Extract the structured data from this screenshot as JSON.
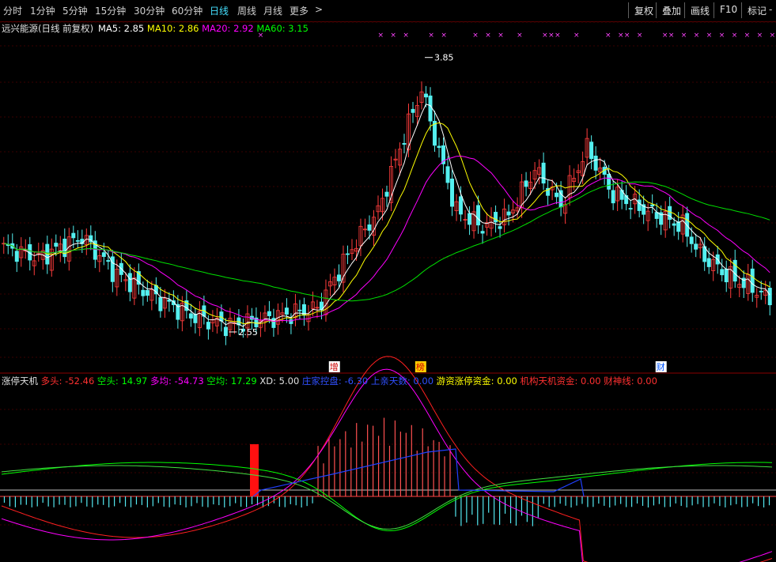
{
  "toolbar": {
    "periods": [
      "分时",
      "1分钟",
      "5分钟",
      "15分钟",
      "30分钟",
      "60分钟",
      "日线",
      "周线",
      "月线",
      "更多"
    ],
    "active_period": "日线",
    "more_arrow": ">",
    "right_buttons": [
      "复权",
      "叠加",
      "画线",
      "F10",
      "标记"
    ],
    "edge": "-"
  },
  "chart_data": [
    {
      "type": "candlestick",
      "title": "远兴能源(日线 前复权)",
      "ma_labels": [
        {
          "name": "MA5",
          "value": "2.85",
          "color": "#ffffff"
        },
        {
          "name": "MA10",
          "value": "2.86",
          "color": "#ffff00"
        },
        {
          "name": "MA20",
          "value": "2.92",
          "color": "#ff00ff"
        },
        {
          "name": "MA60",
          "value": "3.15",
          "color": "#00ff00"
        }
      ],
      "ylim": [
        2.43,
        3.95
      ],
      "high_marker": "3.85",
      "low_marker": "2.55",
      "high_value": 3.85,
      "low_value": 2.55,
      "event_tags": [
        {
          "text": "增",
          "pos": 0.432,
          "bg": "#ffffff",
          "fg": "#cc0000"
        },
        {
          "text": "榜",
          "pos": 0.544,
          "bg": "#ffd000",
          "fg": "#cc0000"
        },
        {
          "text": "财",
          "pos": 0.856,
          "bg": "#ffffff",
          "fg": "#0055ff"
        }
      ],
      "x_mark": "×",
      "x_mark_groups": [
        [
          0.23
        ],
        [
          0.42,
          0.44,
          0.46
        ],
        [
          0.5,
          0.52
        ],
        [
          0.57,
          0.59
        ],
        [
          0.61
        ],
        [
          0.64
        ],
        [
          0.68,
          0.69,
          0.7
        ],
        [
          0.73
        ],
        [
          0.78
        ],
        [
          0.8
        ],
        [
          0.81
        ],
        [
          0.83
        ],
        [
          0.87
        ],
        [
          0.88
        ],
        [
          0.9
        ],
        [
          0.92
        ],
        [
          0.94
        ],
        [
          0.96
        ],
        [
          0.98
        ],
        [
          1.0
        ],
        [
          1.02
        ],
        [
          1.04
        ],
        [
          1.08
        ],
        [
          1.11
        ],
        [
          1.14
        ]
      ],
      "colors": {
        "up": "#ff3c3c",
        "down": "#54f0f0",
        "ma5": "#ffffff",
        "ma10": "#ffff00",
        "ma20": "#ff00ff",
        "ma60": "#00e000"
      }
    },
    {
      "type": "indicator",
      "labels": [
        {
          "name": "涨停天机",
          "value": "",
          "color": "#e0e0e0"
        },
        {
          "name": "多头:",
          "value": "-52.46",
          "color": "#ff3030"
        },
        {
          "name": "空头:",
          "value": "14.97",
          "color": "#00ff00"
        },
        {
          "name": "多均:",
          "value": "-54.73",
          "color": "#ff00ff"
        },
        {
          "name": "空均:",
          "value": "17.29",
          "color": "#00ff00"
        },
        {
          "name": "XD:",
          "value": "5.00",
          "color": "#e0e0e0"
        },
        {
          "name": "庄家控盘:",
          "value": "-6.30",
          "color": "#3050ff"
        },
        {
          "name": "上亲天数:",
          "value": "0.00",
          "color": "#3050ff"
        },
        {
          "name": "游资涨停资金:",
          "value": "0.00",
          "color": "#ffff00"
        },
        {
          "name": "机构天机资金:",
          "value": "0.00",
          "color": "#ff3030"
        },
        {
          "name": "财神线:",
          "value": "0.00",
          "color": "#ff3030"
        }
      ]
    }
  ]
}
